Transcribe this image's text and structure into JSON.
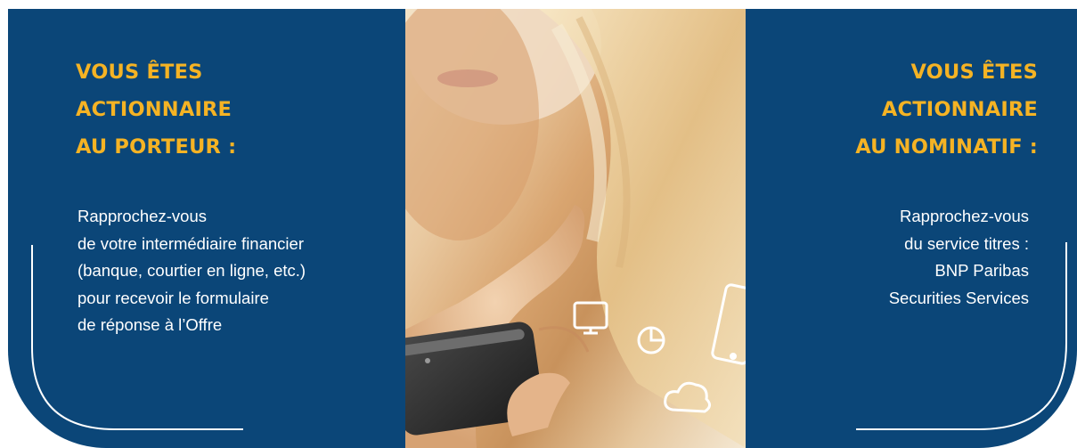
{
  "left_panel": {
    "heading_lines": [
      "VOUS ÊTES",
      "ACTIONNAIRE",
      "AU PORTEUR :"
    ],
    "body_lines": [
      "Rapprochez-vous",
      "de votre intermédiaire financier",
      "(banque, courtier en ligne, etc.)",
      "pour recevoir le formulaire",
      "de réponse à l’Offre"
    ]
  },
  "right_panel": {
    "heading_lines": [
      "VOUS ÊTES",
      "ACTIONNAIRE",
      "AU NOMINATIF :"
    ],
    "body_lines": [
      "Rapprochez-vous",
      "du service titres :",
      "BNP Paribas",
      "Securities Services"
    ]
  },
  "photo": {
    "icons": [
      "monitor-icon",
      "pie-chart-icon",
      "tablet-icon",
      "cloud-icon",
      "smartphone-icon"
    ]
  },
  "colors": {
    "panel_blue": "#0b4678",
    "heading_gold": "#f5b324",
    "text_white": "#ffffff"
  }
}
